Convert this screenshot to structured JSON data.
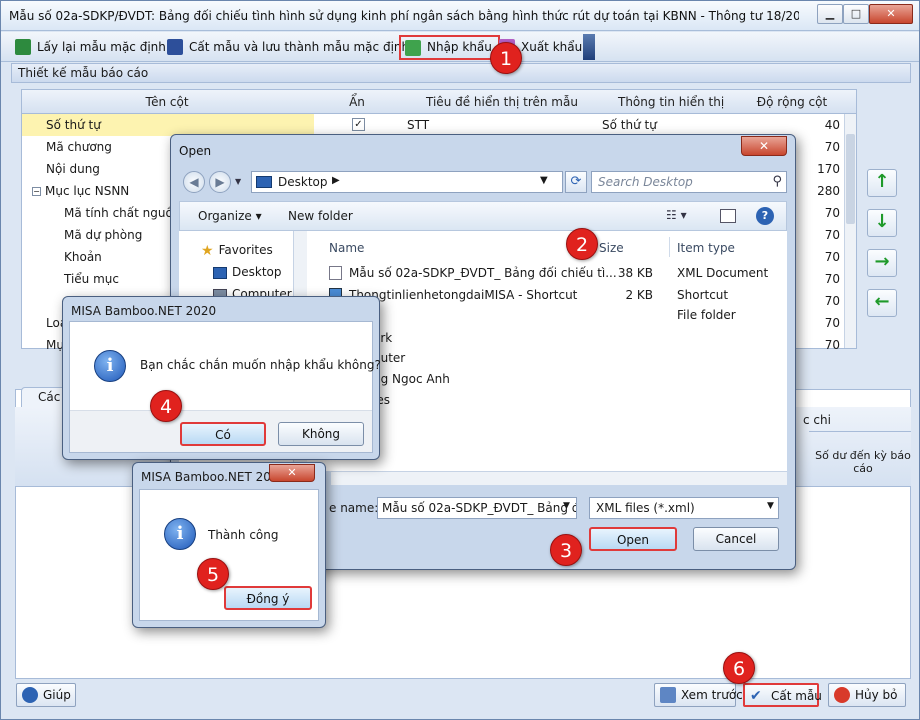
{
  "main_window": {
    "title": "Mẫu số 02a-SDKP/ĐVDT: Bảng đối chiếu tình hình sử dụng kinh phí ngân sách bằng hình thức rút dự toán tại KBNN - Thông tư 18/2020/TT-BTC (M...",
    "controls": {
      "minimize": "▁",
      "maximize": "□",
      "close": "✕"
    }
  },
  "toolbar": {
    "default_template": "Lấy lại mẫu mặc định",
    "save_as_default": "Cất mẫu và lưu thành mẫu mặc định",
    "import": "Nhập khẩu",
    "export": "Xuất khẩu"
  },
  "panel_title": "Thiết kế mẫu báo cáo",
  "grid": {
    "headers": [
      "Tên cột",
      "Ẩn",
      "Tiêu đề hiển thị trên mẫu",
      "Thông tin hiển thị",
      "Độ rộng cột"
    ],
    "rows": [
      {
        "name": "Số thứ tự",
        "hidden": "✓",
        "title": "STT",
        "info": "Số thứ tự",
        "width": "40",
        "indent": 0
      },
      {
        "name": "Mã chương",
        "hidden": "",
        "title": "",
        "info": "",
        "width": "70",
        "indent": 0
      },
      {
        "name": "Nội dung",
        "hidden": "",
        "title": "",
        "info": "",
        "width": "170",
        "indent": 0
      },
      {
        "name": "Mục lục NSNN",
        "hidden": "",
        "title": "",
        "info": "",
        "width": "280",
        "indent": 0,
        "toggle": "−"
      },
      {
        "name": "Mã tính chất nguồn",
        "hidden": "",
        "title": "",
        "info": "",
        "width": "70",
        "indent": 1
      },
      {
        "name": "Mã dự phòng",
        "hidden": "",
        "title": "",
        "info": "",
        "width": "70",
        "indent": 1
      },
      {
        "name": "Khoản",
        "hidden": "",
        "title": "",
        "info": "",
        "width": "70",
        "indent": 1
      },
      {
        "name": "Tiểu mục",
        "hidden": "",
        "title": "",
        "info": "",
        "width": "70",
        "indent": 1
      },
      {
        "name": "",
        "hidden": "",
        "title": "",
        "info": "",
        "width": "70",
        "indent": 1
      },
      {
        "name": "Loa",
        "hidden": "",
        "title": "",
        "info": "",
        "width": "70",
        "indent": 0
      },
      {
        "name": "Mụ",
        "hidden": "",
        "title": "",
        "info": "",
        "width": "70",
        "indent": 0
      }
    ]
  },
  "lower": {
    "tab": "Các",
    "chi_label": "c chi",
    "so_du_label": "Số dư đến kỳ báo cáo"
  },
  "bottom_buttons": {
    "help": "Giúp",
    "preview": "Xem trước",
    "save": "Cất mẫu",
    "cancel": "Hủy bỏ"
  },
  "open_dialog": {
    "title": "Open",
    "close": "✕",
    "back": "◀",
    "forward": "▶",
    "address": "Desktop",
    "address_arrow": "▶",
    "search_placeholder": "Search Desktop",
    "organize": "Organize ▾",
    "new_folder": "New folder",
    "view_menu": "☷ ▾",
    "help": "?",
    "nav_pane": {
      "favorites": "Favorites",
      "desktop": "Desktop",
      "computer": "Computer"
    },
    "columns": {
      "name": "Name",
      "size": "Size",
      "type": "Item type"
    },
    "files": [
      {
        "name": "Mẫu số 02a-SDKP_ĐVDT_ Bảng đối chiếu tì...",
        "size": "38 KB",
        "type": "XML Document"
      },
      {
        "name": "ThongtinlienhetongdaiMISA - Shortcut",
        "size": "2 KB",
        "type": "Shortcut"
      },
      {
        "name": "",
        "size": "",
        "type": "File folder"
      }
    ],
    "partial_items": [
      "ork",
      "puter",
      "ng Ngoc Anh",
      "ies"
    ],
    "filename_label": "e name:",
    "filename_value": "Mẫu số 02a-SDKP_ĐVDT_ Bảng đô",
    "filter": "XML files (*.xml)",
    "open_button": "Open",
    "cancel_button": "Cancel"
  },
  "confirm_dialog": {
    "title": "MISA Bamboo.NET 2020",
    "message": "Bạn chắc chắn muốn nhập khẩu không?",
    "yes": "Có",
    "no": "Không"
  },
  "success_dialog": {
    "title": "MISA Bamboo.NET 2020",
    "close": "✕",
    "message": "Thành công",
    "ok": "Đồng ý"
  },
  "steps": [
    "1",
    "2",
    "3",
    "4",
    "5",
    "6"
  ]
}
